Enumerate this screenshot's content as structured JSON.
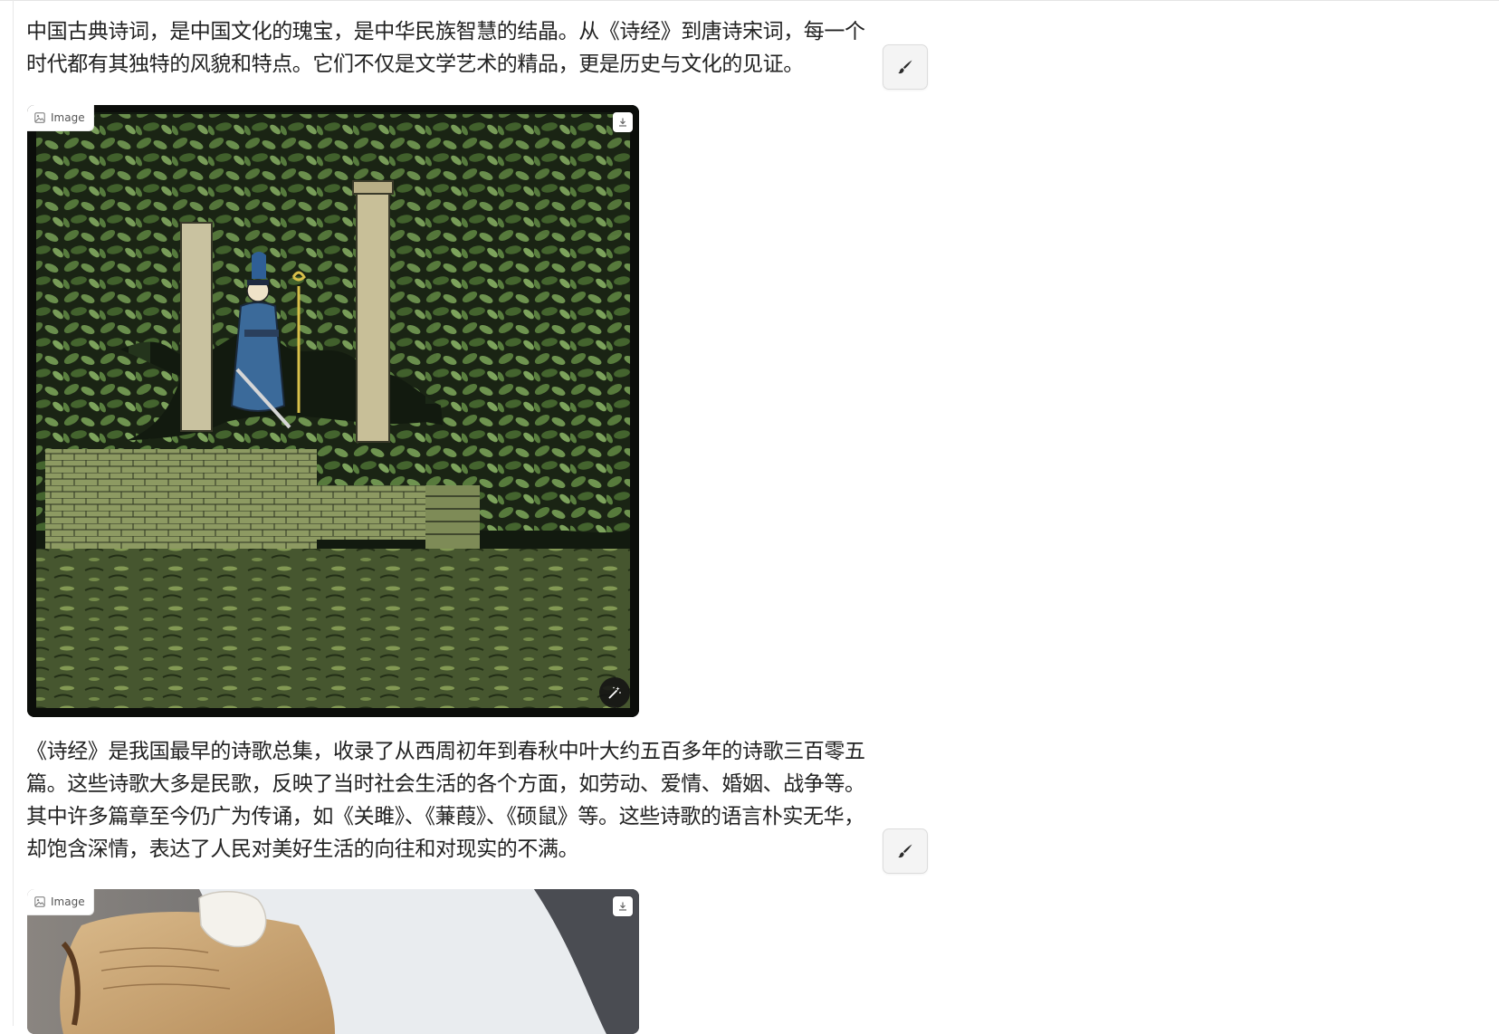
{
  "article": {
    "paragraph_1": "中国古典诗词，是中国文化的瑰宝，是中华民族智慧的结晶。从《诗经》到唐诗宋词，每一个时代都有其独特的风貌和特点。它们不仅是文学艺术的精品，更是历史与文化的见证。",
    "paragraph_2": "《诗经》是我国最早的诗歌总集，收录了从西周初年到春秋中叶大约五百多年的诗歌三百零五篇。这些诗歌大多是民歌，反映了当时社会生活的各个方面，如劳动、爱情、婚姻、战争等。其中许多篇章至今仍广为传诵，如《关雎》、《蒹葭》、《硕鼠》等。这些诗歌的语言朴实无华，却饱含深情，表达了人民对美好生活的向往和对现实的不满。"
  },
  "images": [
    {
      "badge_label": "Image",
      "badge_icon": "image-icon",
      "download_icon": "download-icon",
      "action_icon": "magic-wand-icon"
    },
    {
      "badge_label": "Image",
      "badge_icon": "image-icon",
      "download_icon": "download-icon"
    }
  ],
  "controls": {
    "edit_icon": "brush-icon"
  },
  "colors": {
    "edit_button_bg": "#f4f4f4",
    "illustration_dark": "#0b0d0a",
    "foliage": "#4f6e35",
    "robe_blue": "#3b6a9a"
  }
}
